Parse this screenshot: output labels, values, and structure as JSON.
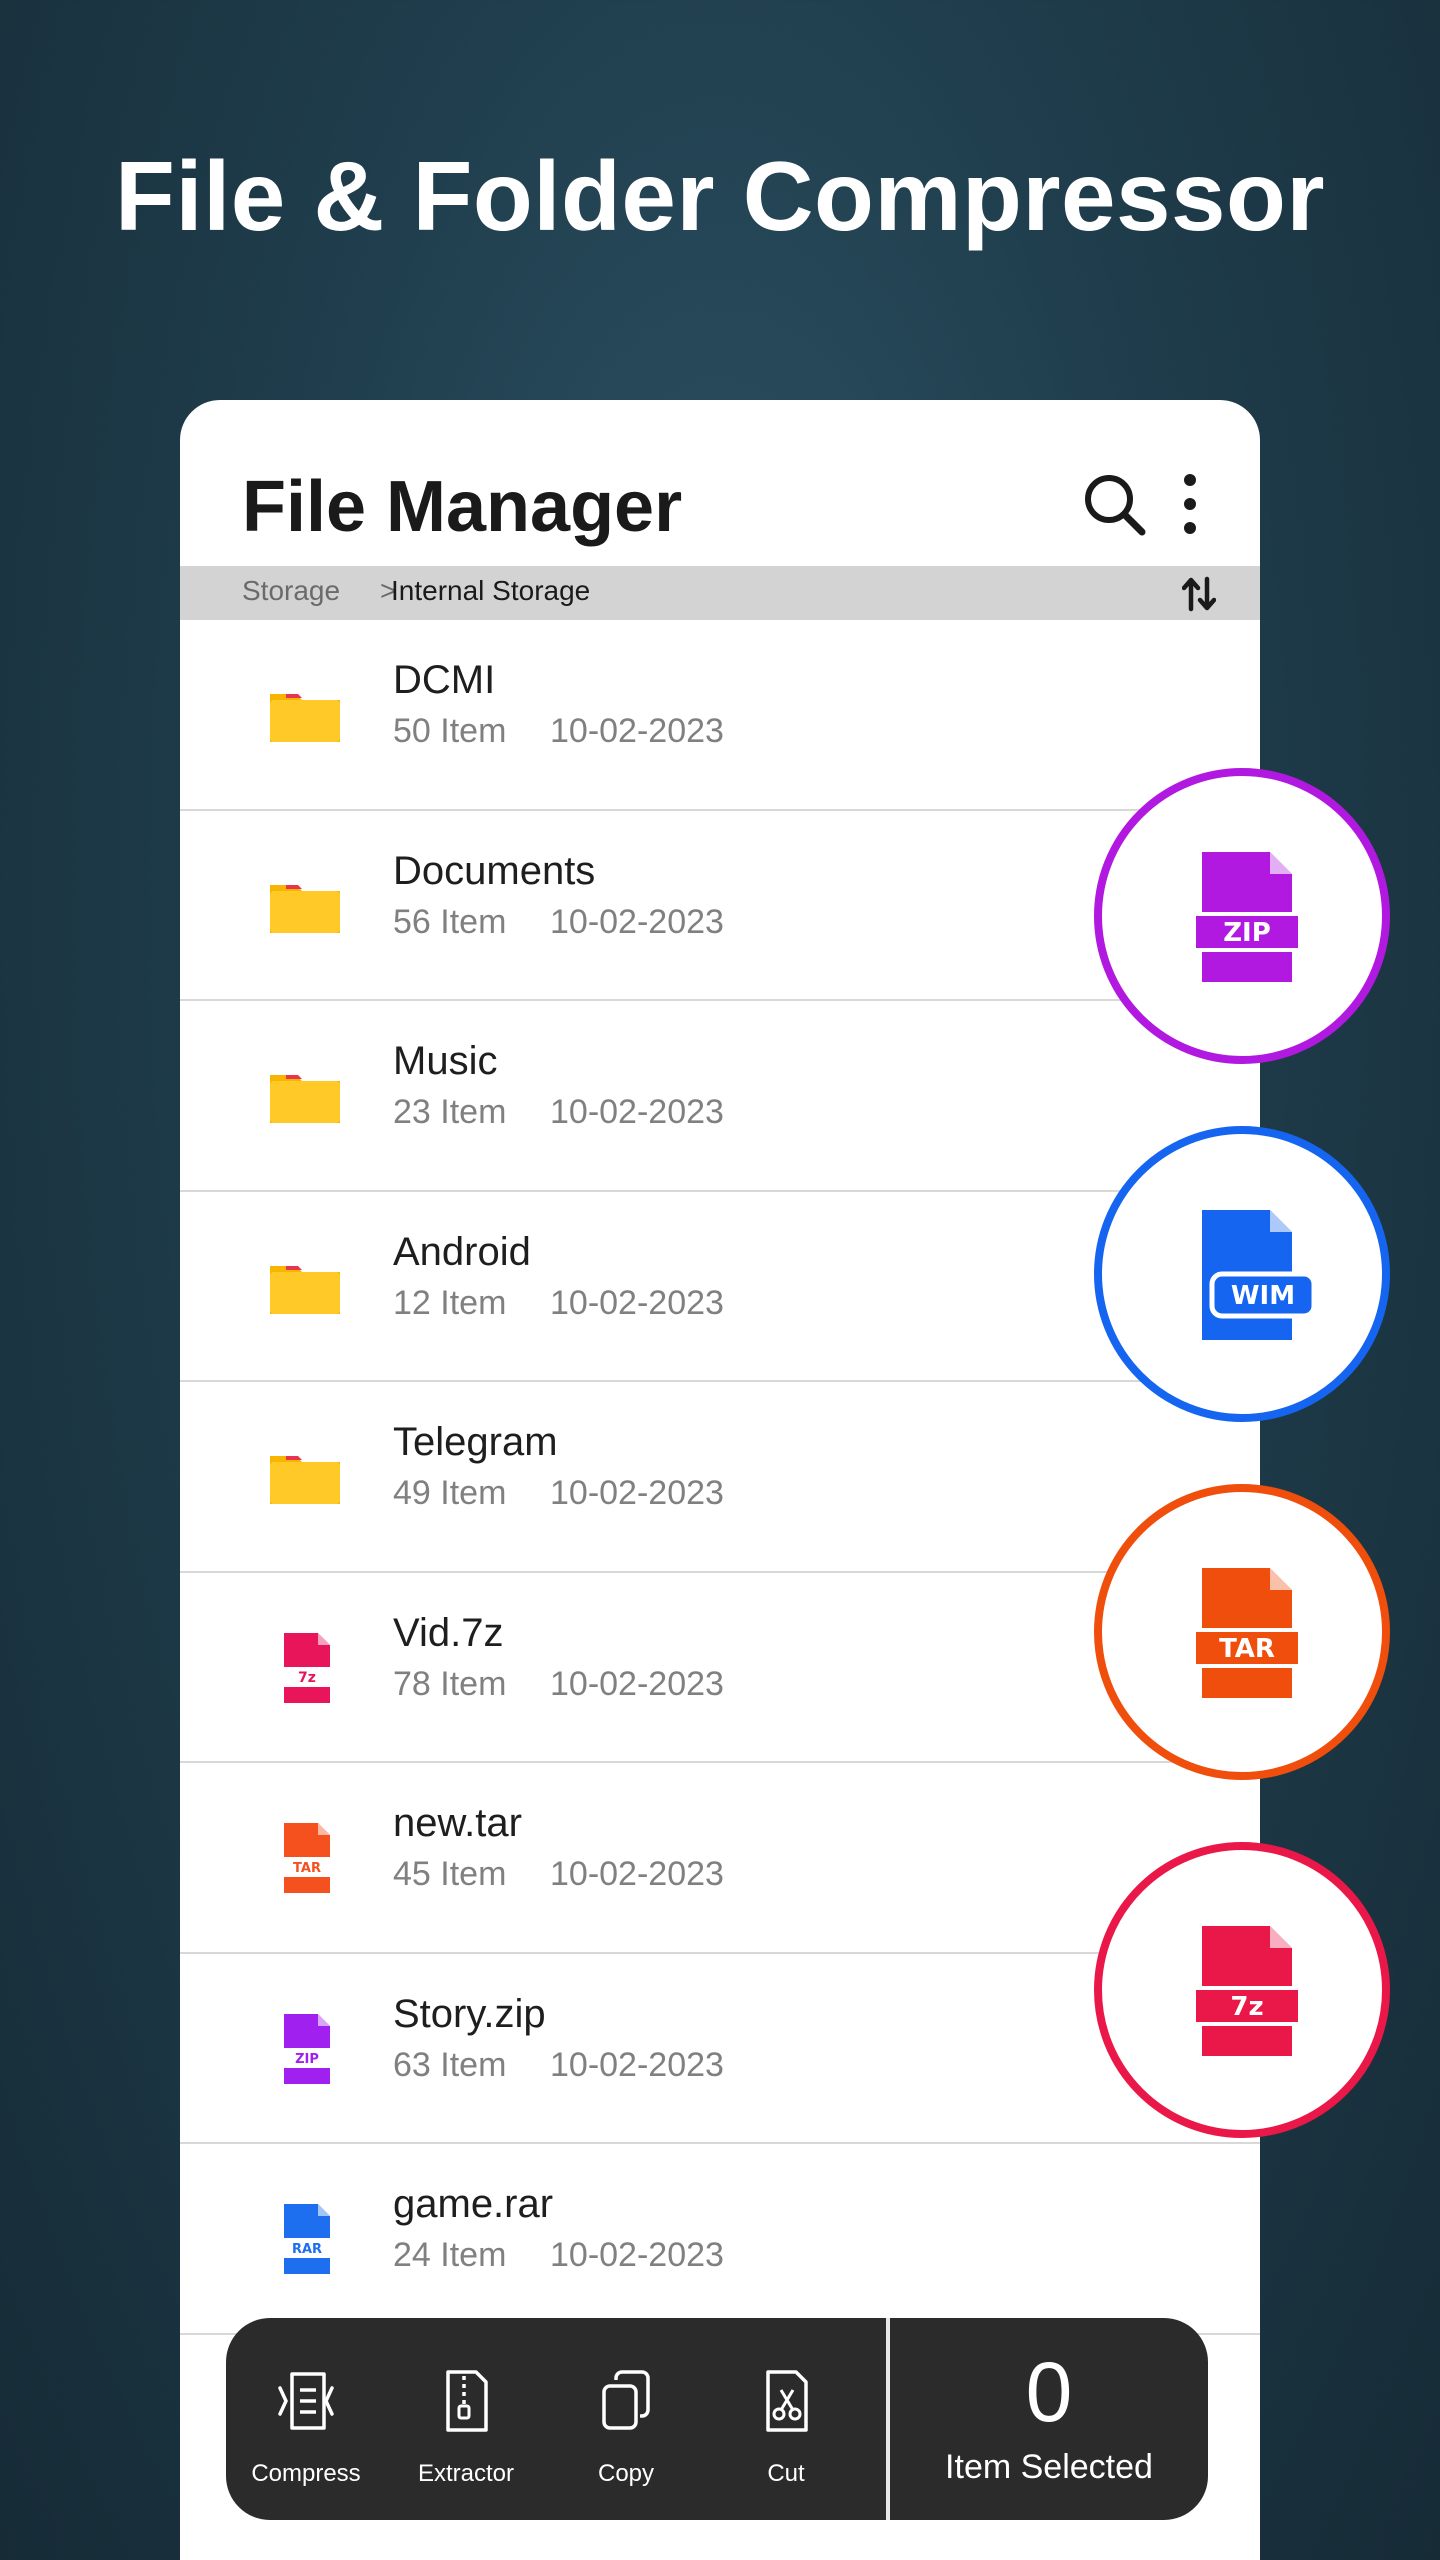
{
  "headline": "File & Folder Compressor",
  "app": {
    "title": "File Manager",
    "search_icon": "search-icon",
    "more_icon": "more-vertical-icon"
  },
  "breadcrumb": {
    "root": "Storage",
    "separator": ">",
    "current": "Internal Storage",
    "sort_icon": "sort-icon"
  },
  "items": [
    {
      "name": "DCMI",
      "count": "50 Item",
      "date": "10-02-2023",
      "icon": "folder-icon"
    },
    {
      "name": "Documents",
      "count": "56 Item",
      "date": "10-02-2023",
      "icon": "folder-icon"
    },
    {
      "name": "Music",
      "count": "23 Item",
      "date": "10-02-2023",
      "icon": "folder-icon"
    },
    {
      "name": "Android",
      "count": "12 Item",
      "date": "10-02-2023",
      "icon": "folder-icon"
    },
    {
      "name": "Telegram",
      "count": "49 Item",
      "date": "10-02-2023",
      "icon": "folder-icon"
    },
    {
      "name": "Vid.7z",
      "count": "78 Item",
      "date": "10-02-2023",
      "icon": "7z-file-icon",
      "tag": "7z",
      "color": "#e8155a"
    },
    {
      "name": "new.tar",
      "count": "45 Item",
      "date": "10-02-2023",
      "icon": "tar-file-icon",
      "tag": "TAR",
      "color": "#f4511e"
    },
    {
      "name": "Story.zip",
      "count": "63 Item",
      "date": "10-02-2023",
      "icon": "zip-file-icon",
      "tag": "ZIP",
      "color": "#a020f0"
    },
    {
      "name": "game.rar",
      "count": "24 Item",
      "date": "10-02-2023",
      "icon": "rar-file-icon",
      "tag": "RAR",
      "color": "#1e6ff0"
    }
  ],
  "badges": [
    {
      "tag": "ZIP",
      "color": "#b219e0",
      "icon": "zip-file-icon"
    },
    {
      "tag": "WIM",
      "color": "#1565f0",
      "icon": "wim-file-icon"
    },
    {
      "tag": "TAR",
      "color": "#f04e0c",
      "icon": "tar-file-icon"
    },
    {
      "tag": "7z",
      "color": "#ea1848",
      "icon": "7z-file-icon"
    }
  ],
  "actions": [
    {
      "label": "Compress",
      "icon": "compress-icon"
    },
    {
      "label": "Extractor",
      "icon": "extractor-icon"
    },
    {
      "label": "Copy",
      "icon": "copy-icon"
    },
    {
      "label": "Cut",
      "icon": "cut-icon"
    }
  ],
  "selection": {
    "count": "0",
    "label": "Item Selected"
  }
}
